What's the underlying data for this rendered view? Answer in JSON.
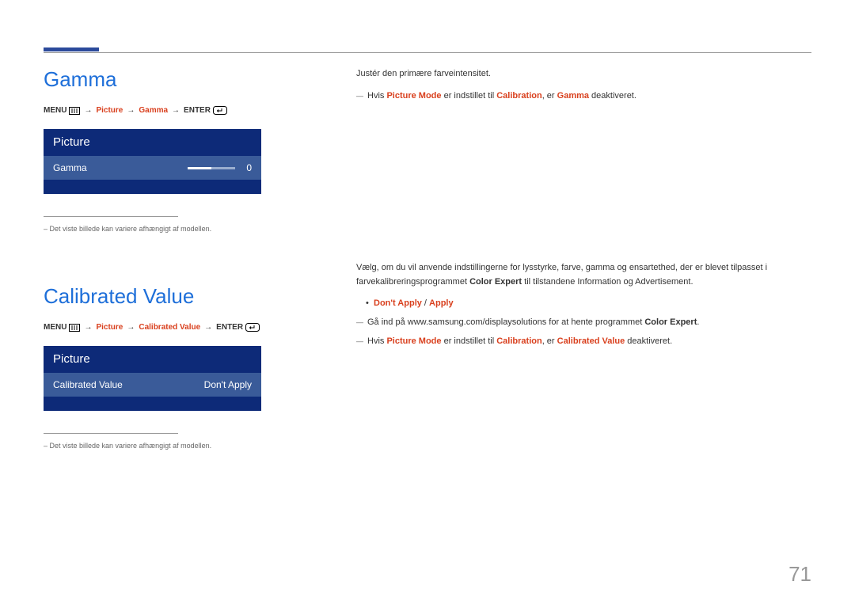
{
  "page_number": "71",
  "sections": {
    "gamma": {
      "title": "Gamma",
      "path": {
        "menu": "MENU",
        "seg1": "Picture",
        "seg2": "Gamma",
        "enter": "ENTER"
      },
      "preview": {
        "header": "Picture",
        "row_label": "Gamma",
        "row_value": "0"
      },
      "caption": "– Det viste billede kan variere afhængigt af modellen.",
      "desc": "Justér den primære farveintensitet.",
      "note_a": "Hvis ",
      "note_b": "Picture Mode",
      "note_c": " er indstillet til ",
      "note_d": "Calibration",
      "note_e": ", er ",
      "note_f": "Gamma",
      "note_g": " deaktiveret."
    },
    "calibrated": {
      "title": "Calibrated Value",
      "path": {
        "menu": "MENU",
        "seg1": "Picture",
        "seg2": "Calibrated Value",
        "enter": "ENTER"
      },
      "preview": {
        "header": "Picture",
        "row_label": "Calibrated Value",
        "row_value": "Don't Apply"
      },
      "caption": "– Det viste billede kan variere afhængigt af modellen.",
      "desc_a": "Vælg, om du vil anvende indstillingerne for lysstyrke, farve, gamma og ensartethed, der er blevet tilpasset i farvekalibreringsprogrammet ",
      "desc_b": "Color Expert",
      "desc_c": " til tilstandene Information og Advertisement.",
      "bullet_a": "Don't Apply",
      "bullet_sep": " / ",
      "bullet_b": "Apply",
      "note1_a": "Gå ind på www.samsung.com/displaysolutions for at hente programmet ",
      "note1_b": "Color Expert",
      "note1_c": ".",
      "note2_a": "Hvis ",
      "note2_b": "Picture Mode",
      "note2_c": " er indstillet til ",
      "note2_d": "Calibration",
      "note2_e": ", er ",
      "note2_f": "Calibrated Value",
      "note2_g": " deaktiveret."
    }
  }
}
